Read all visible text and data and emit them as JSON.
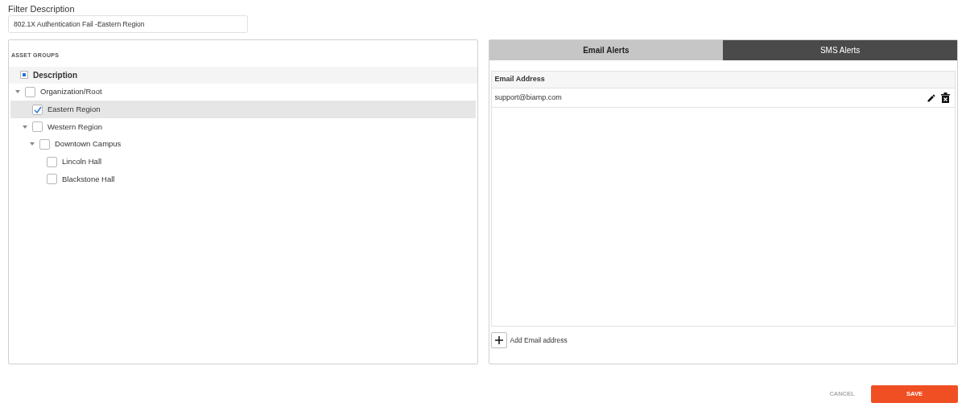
{
  "filter": {
    "label": "Filter Description",
    "value": "802.1X Authentication Fail -Eastern Region"
  },
  "asset_groups": {
    "title": "ASSET GROUPS",
    "header": {
      "label": "Description",
      "indeterminate": true
    },
    "tree": [
      {
        "label": "Organization/Root",
        "checked": false,
        "selected": false,
        "expanded": true,
        "children": [
          {
            "label": "Eastern Region",
            "checked": true,
            "selected": true
          },
          {
            "label": "Western Region",
            "checked": false,
            "selected": false,
            "expanded": true,
            "children": [
              {
                "label": "Downtown Campus",
                "checked": false,
                "selected": false,
                "expanded": true,
                "children": [
                  {
                    "label": "Lincoln Hall",
                    "checked": false,
                    "selected": false
                  },
                  {
                    "label": "Blackstone Hall",
                    "checked": false,
                    "selected": false
                  }
                ]
              }
            ]
          }
        ]
      }
    ]
  },
  "alerts": {
    "tabs": [
      {
        "label": "Email Alerts",
        "selected": true
      },
      {
        "label": "SMS Alerts",
        "selected": false
      }
    ],
    "column": "Email Address",
    "rows": [
      {
        "email": "support@biamp.com"
      }
    ],
    "add_label": "Add Email address"
  },
  "buttons": {
    "cancel": "CANCEL",
    "save": "SAVE"
  }
}
